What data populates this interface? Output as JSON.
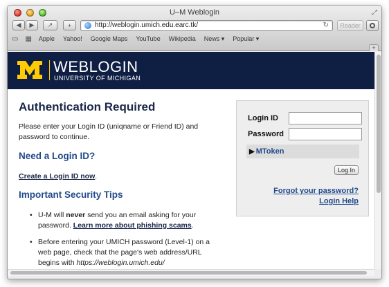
{
  "window": {
    "title": "U–M Weblogin"
  },
  "toolbar": {
    "back": "◀",
    "forward": "▶",
    "share": "↗",
    "add": "+",
    "url": "http://weblogin.umich.edu.earc.tk/",
    "reload": "↻",
    "reader": "Reader"
  },
  "bookmarks": {
    "items": [
      "Apple",
      "Yahoo!",
      "Google Maps",
      "YouTube",
      "Wikipedia",
      "News ▾",
      "Popular ▾"
    ]
  },
  "header": {
    "logo_title": "WEBLOGIN",
    "logo_subtitle": "UNIVERSITY OF MICHIGAN",
    "brand_navy": "#0f1f44",
    "brand_maize": "#ffcb05"
  },
  "main": {
    "heading": "Authentication Required",
    "intro": "Please enter your Login ID (uniqname or Friend ID) and password to continue.",
    "need_heading": "Need a Login ID?",
    "create_link": "Create a Login ID now",
    "create_suffix": ".",
    "tips_heading": "Important Security Tips",
    "tip1_before": "U-M will ",
    "tip1_strong": "never",
    "tip1_after": " send you an email asking for your password. ",
    "tip1_link": "Learn more about phishing scams",
    "tip1_end": ".",
    "tip2_text": "Before entering your UMICH password (Level-1) on a web page, check that the page's web address/URL begins with ",
    "tip2_url": "https://weblogin.umich.edu/"
  },
  "login": {
    "id_label": "Login ID",
    "id_value": "",
    "password_label": "Password",
    "password_value": "",
    "mtoken_label": "MToken",
    "button_label": "Log In",
    "forgot_link": "Forgot your password?",
    "help_link": "Login Help"
  }
}
